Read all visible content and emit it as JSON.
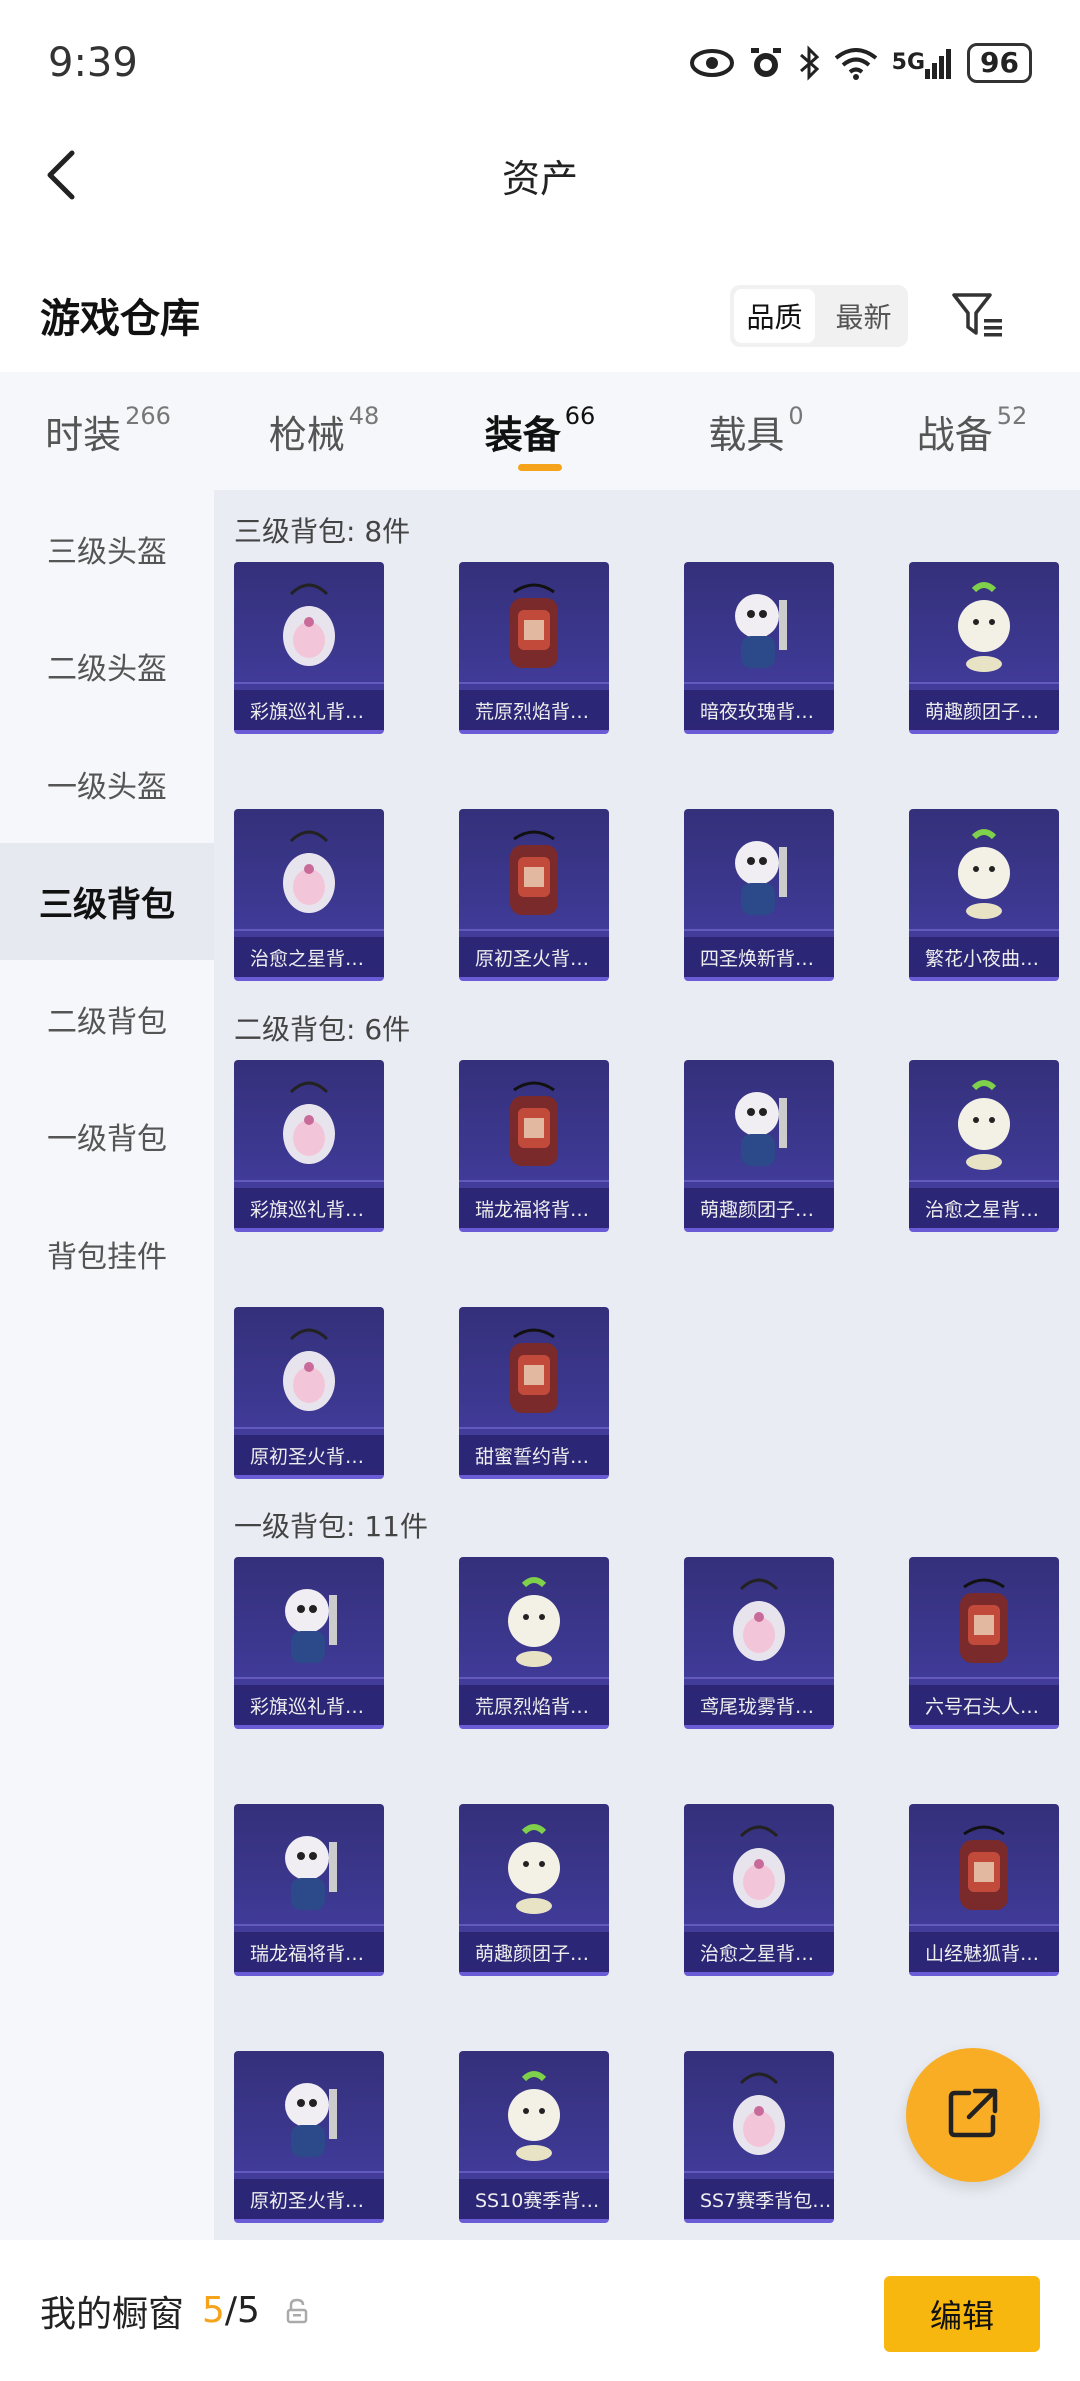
{
  "status_bar": {
    "time": "9:39",
    "network": "5G",
    "battery": "96"
  },
  "header": {
    "title": "资产"
  },
  "repo": {
    "title": "游戏仓库",
    "sort_options": [
      "品质",
      "最新"
    ]
  },
  "tabs": [
    {
      "label": "时装",
      "count": "266"
    },
    {
      "label": "枪械",
      "count": "48"
    },
    {
      "label": "装备",
      "count": "66"
    },
    {
      "label": "载具",
      "count": "0"
    },
    {
      "label": "战备",
      "count": "52"
    }
  ],
  "side_nav": [
    "三级头盔",
    "二级头盔",
    "一级头盔",
    "三级背包",
    "二级背包",
    "一级背包",
    "背包挂件"
  ],
  "sections": [
    {
      "title": "三级背包: 8件",
      "items": [
        "彩旗巡礼背…",
        "荒原烈焰背…",
        "暗夜玫瑰背…",
        "萌趣颜团子…",
        "治愈之星背…",
        "原初圣火背…",
        "四圣焕新背…",
        "繁花小夜曲…"
      ]
    },
    {
      "title": "二级背包: 6件",
      "items": [
        "彩旗巡礼背…",
        "瑞龙福将背…",
        "萌趣颜团子…",
        "治愈之星背…",
        "原初圣火背…",
        "甜蜜誓约背…"
      ]
    },
    {
      "title": "一级背包: 11件",
      "items": [
        "彩旗巡礼背…",
        "荒原烈焰背…",
        "鸢尾珑雾背…",
        "六号石头人…",
        "瑞龙福将背…",
        "萌趣颜团子…",
        "治愈之星背…",
        "山经魅狐背…",
        "原初圣火背…",
        "SS10赛季背…",
        "SS7赛季背包…"
      ]
    }
  ],
  "bottom_bar": {
    "label": "我的橱窗",
    "count_current": "5",
    "count_total": "/5",
    "edit_label": "编辑"
  },
  "colors": {
    "accent": "#f4a31a",
    "card_bg": "#3c3890",
    "edit_button": "#f8b70e"
  }
}
